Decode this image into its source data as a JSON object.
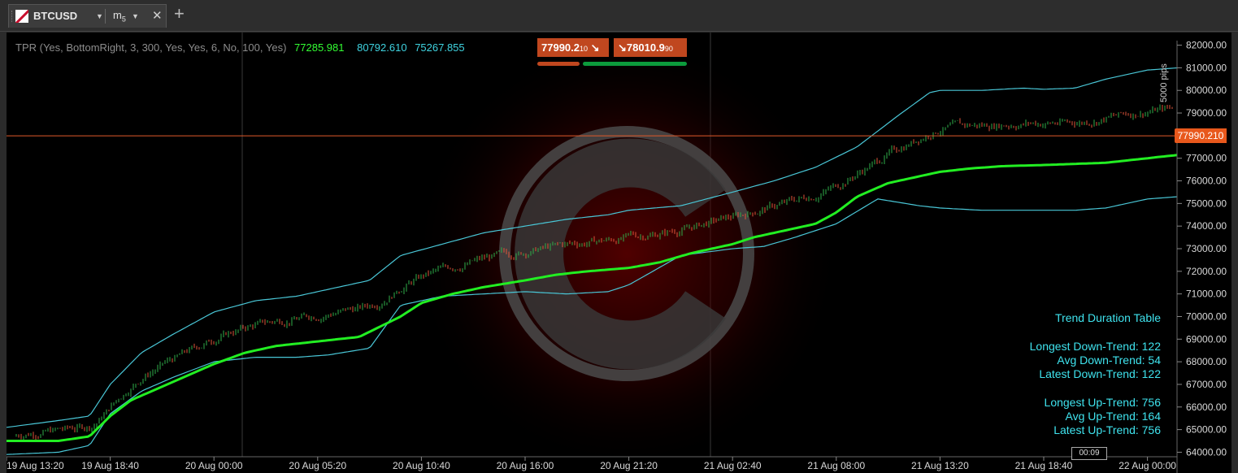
{
  "tab": {
    "symbol": "BTCUSD",
    "timeframe_main": "m",
    "timeframe_sub": "5",
    "close_glyph": "✕",
    "new_tab_glyph": "+"
  },
  "legend": {
    "indicator": "TPR (Yes, BottomRight, 3, 300, Yes, Yes, 6, No, 100, Yes)",
    "value1": "77285.981",
    "value2": "80792.610",
    "value3": "75267.855"
  },
  "quotes": {
    "sell_main": "77990.2",
    "sell_sup": "10",
    "buy_main": "78010.9",
    "buy_sup": "90"
  },
  "current_price_label": "77990.210",
  "pips_label": "5000 pips",
  "timer_label": "00:09",
  "trend_table": {
    "title": "Trend Duration Table",
    "longest_down": "Longest Down-Trend: 122",
    "avg_down": "Avg Down-Trend: 54",
    "latest_down": "Latest Down-Trend: 122",
    "longest_up": "Longest Up-Trend: 756",
    "avg_up": "Avg Up-Trend: 164",
    "latest_up": "Latest Up-Trend: 756"
  },
  "colors": {
    "background": "#000000",
    "trend_line": "#22ee22",
    "band_line": "#49c6d6",
    "candle_up": "#2fae4a",
    "candle_down": "#e0553a",
    "price_line": "#e05a2b",
    "sell_button": "#c0471f",
    "spread_bar_red": "#c0471f",
    "spread_bar_green": "#0c9b3c"
  },
  "icons": [
    "currency-flag-icon",
    "dropdown-arrow-icon",
    "close-icon",
    "plus-icon",
    "watermark-logo"
  ],
  "chart_data": {
    "type": "line",
    "y_axis": {
      "ticks": [
        "82000.00",
        "81000.00",
        "80000.00",
        "79000.00",
        "78000.00",
        "77000.00",
        "76000.00",
        "75000.00",
        "74000.00",
        "73000.00",
        "72000.00",
        "71000.00",
        "70000.00",
        "69000.00",
        "68000.00",
        "67000.00",
        "66000.00",
        "65000.00",
        "64000.00"
      ],
      "ylim": [
        63800,
        82200
      ]
    },
    "x_axis": {
      "ticks": [
        "19 Aug 13:20",
        "19 Aug 18:40",
        "20 Aug 00:00",
        "20 Aug 05:20",
        "20 Aug 10:40",
        "20 Aug 16:00",
        "20 Aug 21:20",
        "21 Aug 02:40",
        "21 Aug 08:00",
        "21 Aug 13:20",
        "21 Aug 18:40",
        "22 Aug 00:00"
      ]
    },
    "grid": true,
    "current_price": 77990.21,
    "series": [
      {
        "x": [
          0,
          0.5,
          0.8,
          1,
          1.2,
          1.5,
          1.8,
          2,
          2.3,
          2.6,
          3,
          3.4,
          3.8,
          4,
          4.3,
          4.6,
          5,
          5.3,
          5.6,
          6,
          6.3,
          6.6,
          7,
          7.2,
          7.5,
          7.8,
          8,
          8.2,
          8.5,
          8.8,
          9,
          9.3,
          9.6,
          10,
          10.3,
          10.6,
          11,
          11.3
        ],
        "values": [
          64500,
          64500,
          64700,
          65600,
          66300,
          66900,
          67500,
          67900,
          68400,
          68700,
          68900,
          69100,
          70000,
          70600,
          71000,
          71300,
          71600,
          71850,
          72000,
          72150,
          72400,
          72800,
          73200,
          73500,
          73800,
          74100,
          74600,
          75300,
          75900,
          76200,
          76400,
          76550,
          76650,
          76700,
          76750,
          76800,
          77000,
          77150
        ]
      },
      {
        "x": [
          0,
          0.5,
          0.8,
          1,
          1.3,
          1.6,
          2,
          2.4,
          2.8,
          3.1,
          3.5,
          3.8,
          4.2,
          4.6,
          5,
          5.4,
          5.8,
          6,
          6.5,
          7,
          7.4,
          7.8,
          8.2,
          8.6,
          8.9,
          9,
          9.4,
          9.8,
          10,
          10.3,
          10.6,
          11,
          11.3
        ],
        "values": [
          65100,
          65400,
          65600,
          67000,
          68400,
          69200,
          70200,
          70700,
          70900,
          71200,
          71600,
          72700,
          73200,
          73700,
          74000,
          74300,
          74500,
          74700,
          74900,
          75500,
          76000,
          76600,
          77500,
          78900,
          79900,
          80000,
          80000,
          80100,
          80050,
          80100,
          80500,
          80900,
          81000
        ]
      },
      {
        "x": [
          0,
          0.5,
          0.8,
          1,
          1.3,
          1.6,
          2,
          2.4,
          2.8,
          3.1,
          3.5,
          3.8,
          4.2,
          4.6,
          5,
          5.4,
          5.8,
          6,
          6.5,
          7,
          7.3,
          7.6,
          8,
          8.4,
          8.8,
          9,
          9.4,
          9.8,
          10,
          10.3,
          10.6,
          11,
          11.3
        ],
        "values": [
          63900,
          64000,
          64300,
          65700,
          66700,
          67300,
          68000,
          68200,
          68200,
          68300,
          68600,
          70500,
          70900,
          71000,
          71100,
          71000,
          71100,
          71400,
          72700,
          73000,
          73100,
          73500,
          74100,
          75200,
          74900,
          74800,
          74700,
          74700,
          74700,
          74700,
          74800,
          75200,
          75300
        ]
      }
    ]
  }
}
